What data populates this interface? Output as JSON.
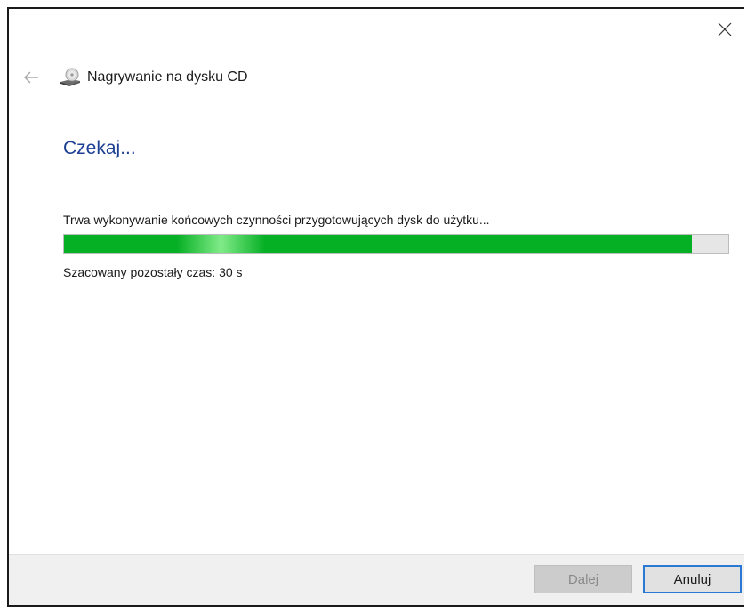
{
  "window": {
    "title": "Nagrywanie na dysku CD",
    "back_icon": "arrow-left-icon",
    "app_icon": "cd-drive-icon",
    "close_icon": "close-icon"
  },
  "main": {
    "heading": "Czekaj...",
    "status_text": "Trwa wykonywanie końcowych czynności przygotowujących dysk do użytku...",
    "progress_fraction": 0.945,
    "eta_text": "Szacowany pozostały czas: 30 s"
  },
  "footer": {
    "next_label": "Dalej",
    "next_enabled": false,
    "cancel_label": "Anuluj"
  },
  "colors": {
    "heading": "#1c3f94",
    "progress_fill": "#06b025",
    "focus_border": "#2a7ad5"
  }
}
